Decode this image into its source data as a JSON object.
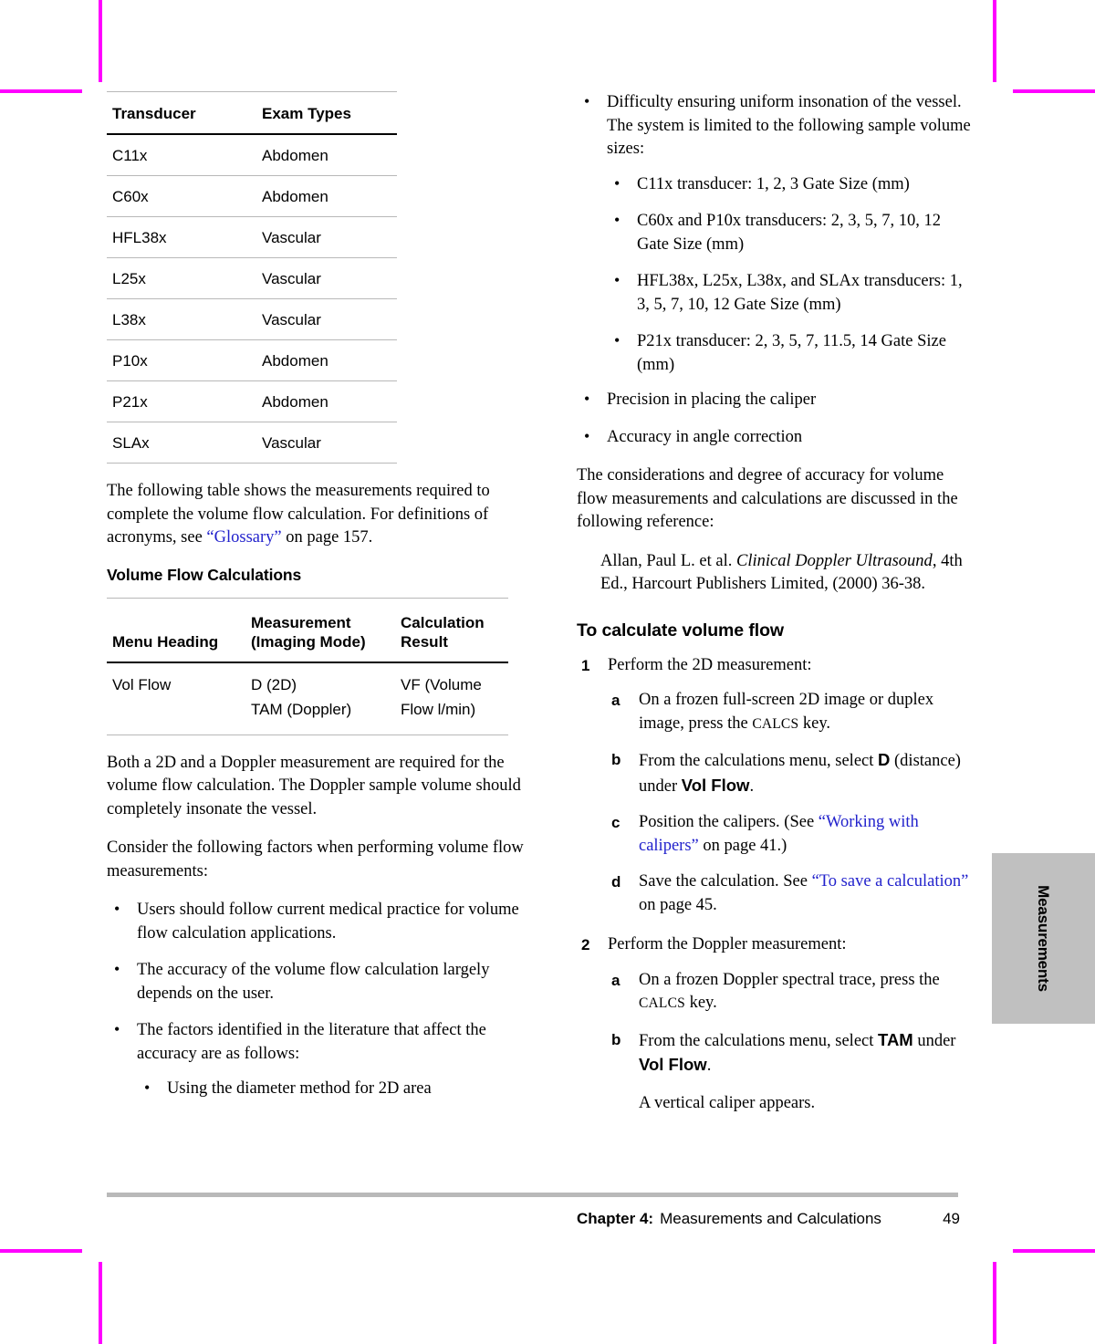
{
  "page": {
    "footer": {
      "chapter_label": "Chapter 4:",
      "chapter_title": "Measurements and Calculations",
      "page_number": "49"
    },
    "side_tab": {
      "label": "Measurements"
    }
  },
  "left_column": {
    "transducer_table": {
      "columns": [
        "Transducer",
        "Exam Types"
      ],
      "rows": [
        [
          "C11x",
          "Abdomen"
        ],
        [
          "C60x",
          "Abdomen"
        ],
        [
          "HFL38x",
          "Vascular"
        ],
        [
          "L25x",
          "Vascular"
        ],
        [
          "L38x",
          "Vascular"
        ],
        [
          "P10x",
          "Abdomen"
        ],
        [
          "P21x",
          "Abdomen"
        ],
        [
          "SLAx",
          "Vascular"
        ]
      ]
    },
    "intro_paragraph": {
      "part1": "The following table shows the measurements required to complete the volume flow calculation. For definitions of acronyms, see ",
      "link": "“Glossary”",
      "part2": " on page 157."
    },
    "subheading": "Volume Flow Calculations",
    "volume_flow_table": {
      "columns": [
        "Menu Heading",
        "Measurement (Imaging Mode)",
        "Calculation Result"
      ],
      "rows": [
        {
          "menu_heading": "Vol Flow",
          "measurement_lines": [
            "D (2D)",
            "TAM (Doppler)"
          ],
          "calculation_lines": [
            "VF (Volume",
            "Flow l/min)"
          ]
        }
      ]
    },
    "paragraph_both": "Both a 2D and a Doppler measurement are required for the volume flow calculation. The Doppler sample volume should completely insonate the vessel.",
    "paragraph_consider": "Consider the following factors when performing volume flow measurements:",
    "factors": [
      "Users should follow current medical practice for volume flow calculation applications.",
      "The accuracy of the volume flow calculation largely depends on the user.",
      "The factors identified in the literature that affect the accuracy are as follows:"
    ],
    "sub_factor_first": "Using the diameter method for 2D area"
  },
  "right_column": {
    "continued_bullet": {
      "line1": "Difficulty ensuring uniform insonation of the vessel.",
      "line2": "The system is limited to the following sample volume sizes:"
    },
    "gate_sizes": [
      "C11x transducer: 1, 2, 3 Gate Size (mm)",
      "C60x and P10x transducers: 2, 3, 5, 7, 10, 12 Gate Size (mm)",
      "HFL38x, L25x, L38x, and SLAx transducers: 1, 3, 5, 7, 10, 12 Gate Size (mm)",
      "P21x transducer: 2, 3, 5, 7, 11.5, 14 Gate Size (mm)"
    ],
    "more_factors": [
      "Precision in placing the caliper",
      "Accuracy in angle correction"
    ],
    "considerations_paragraph": "The considerations and degree of accuracy for volume flow measurements and calculations are discussed in the following reference:",
    "reference": {
      "authors": "Allan, Paul L. et al. ",
      "title": "Clinical Doppler Ultrasound",
      "rest": ", 4th Ed., Harcourt Publishers Limited, (2000) 36-38."
    },
    "procedure_heading": "To calculate volume flow",
    "steps": [
      {
        "number": "1",
        "text": "Perform the 2D measurement:",
        "substeps": [
          {
            "letter": "a",
            "pre": "On a frozen full-screen 2D image or duplex image, press the ",
            "key": "CALCS",
            "post": " key."
          },
          {
            "letter": "b",
            "pre": "From the calculations menu, select ",
            "bold1": "D",
            "mid": " (distance) under ",
            "bold2": "Vol Flow",
            "post": "."
          },
          {
            "letter": "c",
            "pre": "Position the calipers. (See ",
            "link": "“Working with calipers”",
            "post": " on page 41.)"
          },
          {
            "letter": "d",
            "pre": "Save the calculation. See ",
            "link": "“To save a calculation”",
            "post": " on page 45."
          }
        ]
      },
      {
        "number": "2",
        "text": "Perform the Doppler measurement:",
        "substeps": [
          {
            "letter": "a",
            "pre": "On a frozen Doppler spectral trace, press the ",
            "key": "CALCS",
            "post": " key."
          },
          {
            "letter": "b",
            "pre": "From the calculations menu, select ",
            "bold1": "TAM",
            "mid": " under ",
            "bold2": "Vol Flow",
            "post": ".",
            "note": "A vertical caliper appears."
          }
        ]
      }
    ]
  },
  "colors": {
    "link": "#2222cc",
    "crop_mark": "#ff00ff",
    "side_tab": "#c0c0c0",
    "footer_rule": "#b9b9b9"
  },
  "bullet_glyph": "•"
}
